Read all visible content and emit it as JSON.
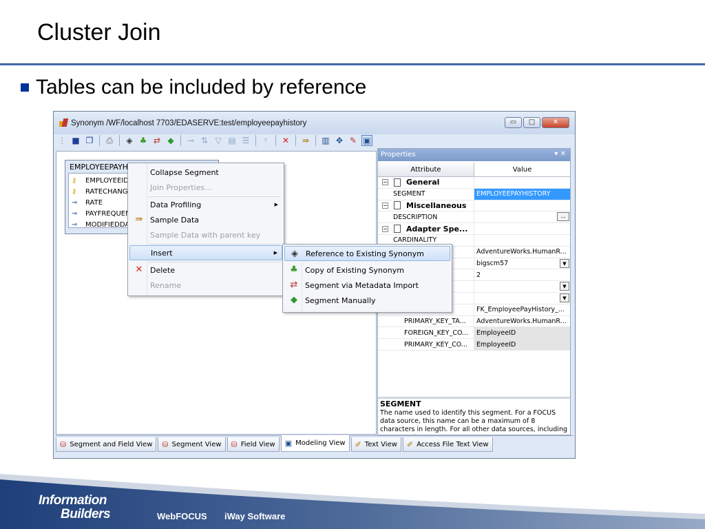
{
  "slide": {
    "title": "Cluster Join",
    "bullet": "Tables can be included by reference"
  },
  "window": {
    "title": "Synonym /WF/localhost 7703/EDASERVE:test/employeepayhistory",
    "min_label": "▭",
    "max_label": "□",
    "close_label": "✕"
  },
  "segment": {
    "name": "EMPLOYEEPAYHI",
    "fields": [
      "EMPLOYEEID",
      "RATECHANGE",
      "RATE",
      "PAYFREQUEN",
      "MODIFIEDDA"
    ]
  },
  "context_menu": {
    "collapse": "Collapse Segment",
    "join_props": "Join Properties...",
    "profiling": "Data Profiling",
    "sample": "Sample Data",
    "sample_parent": "Sample Data with parent key",
    "insert": "Insert",
    "delete": "Delete",
    "rename": "Rename"
  },
  "submenu": {
    "reference": "Reference to Existing Synonym",
    "copy": "Copy of Existing Synonym",
    "metadata": "Segment via Metadata Import",
    "manual": "Segment Manually"
  },
  "properties": {
    "header": "Properties",
    "col_attr": "Attribute",
    "col_value": "Value",
    "group_general": "General",
    "segment_attr": "SEGMENT",
    "segment_val": "EMPLOYEEPAYHISTORY",
    "group_misc": "Miscellaneous",
    "desc_attr": "DESCRIPTION",
    "group_adapter": "Adapter Spe...",
    "cardinality": "CARDINALITY",
    "val_tablename": "AdventureWorks.HumanR...",
    "val_server": "bigscm57",
    "val_count": "2",
    "val_fk": "FK_EmployeePayHistory_...",
    "pk_table_attr": "PRIMARY_KEY_TA...",
    "pk_table_val": "AdventureWorks.HumanR...",
    "fk_col_attr": "FOREIGN_KEY_CO...",
    "fk_col_val": "EmployeeID",
    "pk_col_attr": "PRIMARY_KEY_CO...",
    "pk_col_val": "EmployeeID",
    "desc_title": "SEGMENT",
    "desc_text": "The name used to identify this segment. For a FOCUS data source, this name can be a maximum of 8 characters in length. For all other data sources, including XFOCUS, the"
  },
  "tabs": [
    "Segment and Field View",
    "Segment View",
    "Field View",
    "Modeling View",
    "Text View",
    "Access File Text View"
  ],
  "footer": {
    "logo_line1": "Information",
    "logo_line2": "Builders",
    "link1": "WebFOCUS",
    "link2": "iWay Software"
  },
  "colors": {
    "accent": "#003399",
    "selection": "#3399ff"
  }
}
